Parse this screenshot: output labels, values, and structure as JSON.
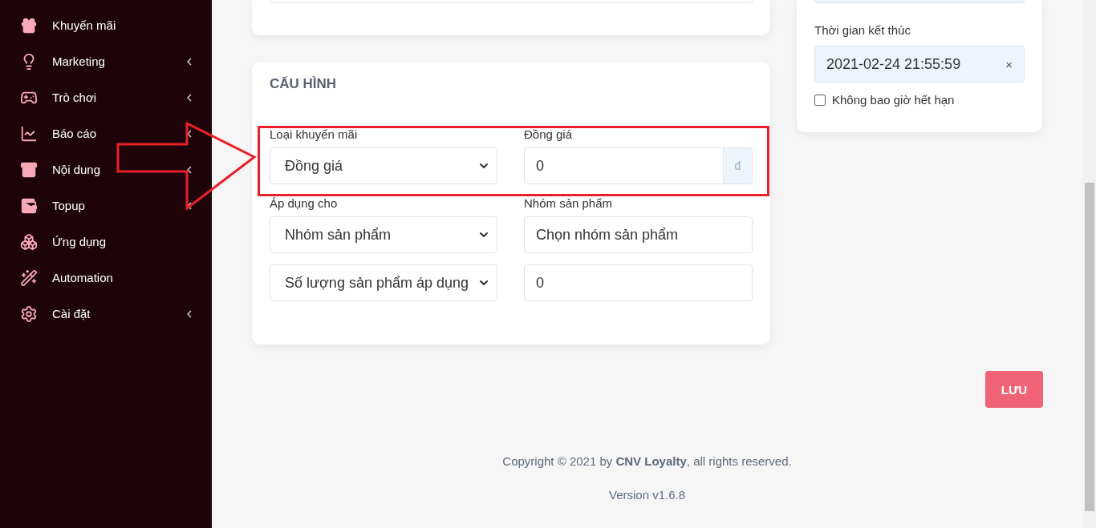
{
  "sidebar": {
    "items": [
      {
        "label": "Khuyến mãi",
        "has_submenu": false
      },
      {
        "label": "Marketing",
        "has_submenu": true
      },
      {
        "label": "Trò chơi",
        "has_submenu": true
      },
      {
        "label": "Báo cáo",
        "has_submenu": true
      },
      {
        "label": "Nội dung",
        "has_submenu": true
      },
      {
        "label": "Topup",
        "has_submenu": true
      },
      {
        "label": "Ứng dụng",
        "has_submenu": false
      },
      {
        "label": "Automation",
        "has_submenu": false
      },
      {
        "label": "Cài đặt",
        "has_submenu": true
      }
    ]
  },
  "config_card": {
    "title": "CẤU HÌNH",
    "rows": [
      [
        {
          "kind": "select",
          "label": "Loại khuyến mãi",
          "value": "Đồng giá"
        },
        {
          "kind": "addon",
          "label": "Đồng giá",
          "value": "0",
          "addon": "đ"
        }
      ],
      [
        {
          "kind": "select",
          "label": "Áp dụng cho",
          "value": "Nhóm sản phẩm"
        },
        {
          "kind": "input",
          "label": "Nhóm sản phẩm",
          "placeholder": "Chọn nhóm sản phẩm"
        }
      ],
      [
        {
          "kind": "select",
          "value": "Số lượng sản phẩm áp dụng"
        },
        {
          "kind": "input",
          "value": "0"
        }
      ]
    ]
  },
  "time_card": {
    "end_label": "Thời gian kết thúc",
    "end_value": "2021-02-24 21:55:59",
    "clear": "×",
    "never_expire": {
      "label": "Không bao giờ hết hạn",
      "checked": false
    }
  },
  "save_button": "LƯU",
  "footer": {
    "copyright": "Copyright © 2021 by **CNV Loyalty**, all rights reserved.",
    "version": "Version v1.6.8"
  },
  "annotations": {
    "arrow": true,
    "highlight_frame": true
  }
}
